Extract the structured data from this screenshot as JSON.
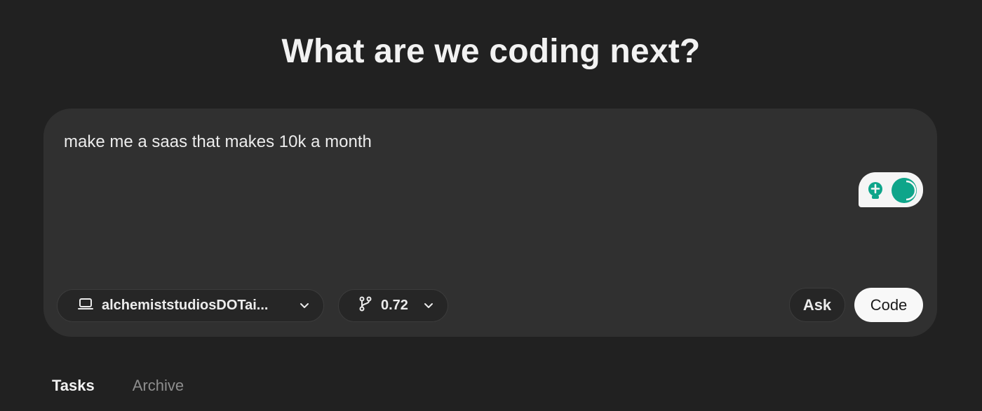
{
  "heading": "What are we coding next?",
  "composer": {
    "prompt_text": "make me a saas that makes 10k a month",
    "extension_widget": {
      "icons": [
        "lightbulb-icon",
        "moon-icon"
      ],
      "accent_color": "#0ea58a"
    },
    "environment_selector": {
      "icon": "laptop-icon",
      "value": "alchemiststudiosDOTai..."
    },
    "branch_selector": {
      "icon": "git-branch-icon",
      "value": "0.72"
    },
    "ask_button": "Ask",
    "code_button": "Code"
  },
  "tabs": [
    {
      "label": "Tasks",
      "active": true
    },
    {
      "label": "Archive",
      "active": false
    }
  ],
  "colors": {
    "background": "#212121",
    "composer": "#303030",
    "accent": "#0ea58a"
  }
}
